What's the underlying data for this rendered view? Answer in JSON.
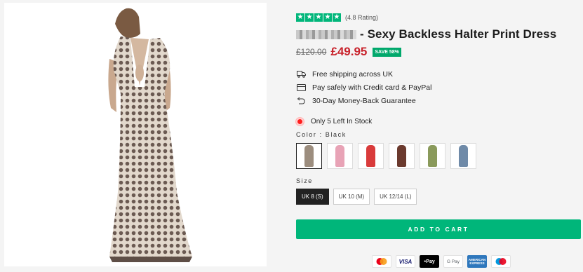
{
  "rating": {
    "stars": 5,
    "text": "(4.8 Rating)"
  },
  "product": {
    "title": "- Sexy Backless Halter Print Dress",
    "old_price": "£120.00",
    "new_price": "£49.95",
    "save_badge": "SAVE 58%"
  },
  "features": [
    {
      "icon": "truck-icon",
      "text": "Free shipping across UK"
    },
    {
      "icon": "credit-card-icon",
      "text": "Pay safely with Credit card & PayPal"
    },
    {
      "icon": "return-arrow-icon",
      "text": "30-Day Money-Back Guarantee"
    }
  ],
  "stock": {
    "text": "Only 5 Left In Stock",
    "dot_color": "#ff1e1e"
  },
  "color": {
    "label": "Color : Black",
    "swatches": [
      {
        "color": "#9c8d7e",
        "selected": true
      },
      {
        "color": "#e8a3b6",
        "selected": false
      },
      {
        "color": "#d93b3b",
        "selected": false
      },
      {
        "color": "#6b3a2e",
        "selected": false
      },
      {
        "color": "#8a9a5b",
        "selected": false
      },
      {
        "color": "#6f8aa8",
        "selected": false
      }
    ]
  },
  "size": {
    "label": "Size",
    "options": [
      "UK 8 (S)",
      "UK 10 (M)",
      "UK 12/14 (L)"
    ],
    "selected": "UK 8 (S)"
  },
  "cart": {
    "label": "ADD TO CART"
  },
  "payments": [
    {
      "name": "mastercard-icon",
      "label": ""
    },
    {
      "name": "visa-icon",
      "label": "VISA"
    },
    {
      "name": "apple-pay-icon",
      "label": "Pay"
    },
    {
      "name": "google-pay-icon",
      "label": "G Pay"
    },
    {
      "name": "amex-icon",
      "label": "AMERICAN EXPRESS"
    },
    {
      "name": "maestro-icon",
      "label": ""
    }
  ],
  "colors": {
    "accent": "#00b67a",
    "price_red": "#c8232c",
    "badge_green": "#00a86b"
  }
}
